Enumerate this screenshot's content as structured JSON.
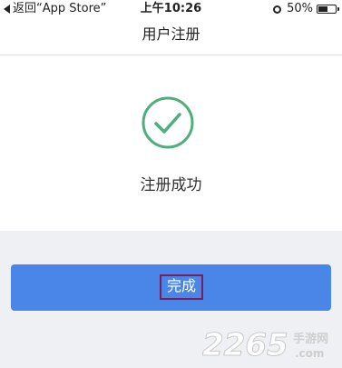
{
  "status_bar": {
    "back_label": "返回“App Store”",
    "time": "上午10:26",
    "battery_text": "50%",
    "battery_level": 0.5
  },
  "nav": {
    "title": "用户注册"
  },
  "content": {
    "success_icon": "check-circle-icon",
    "success_text": "注册成功"
  },
  "actions": {
    "done_label": "完成"
  },
  "watermark": {
    "brand": "2265",
    "domain": "手游网",
    "suffix": ".com"
  },
  "colors": {
    "accent": "#4a86e8",
    "success": "#4caf7d",
    "background": "#eff0f4"
  }
}
